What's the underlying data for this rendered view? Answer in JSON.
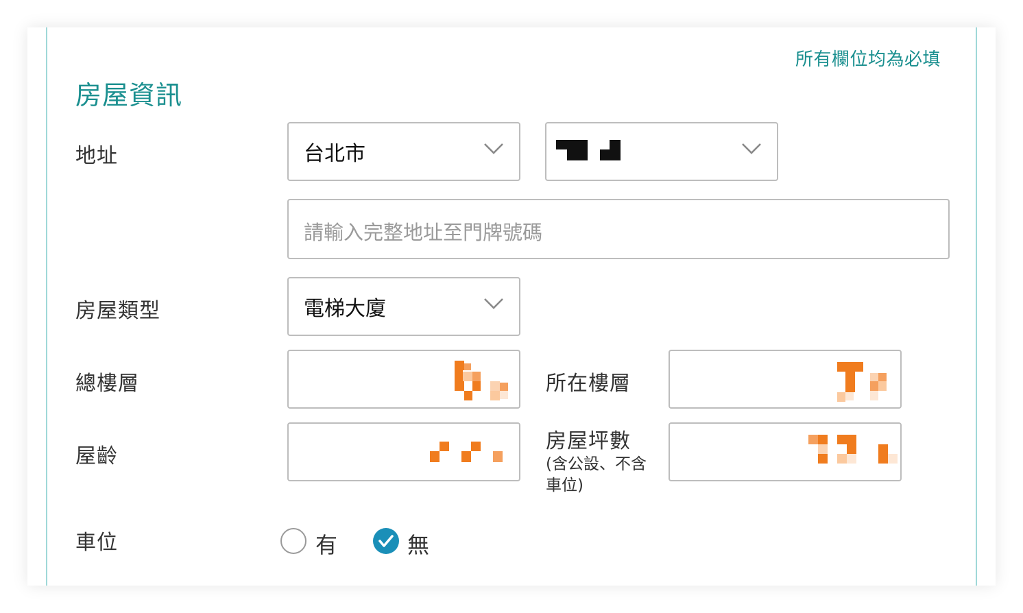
{
  "form": {
    "required_note": "所有欄位均為必填",
    "section_title": "房屋資訊",
    "address": {
      "label": "地址",
      "city": "台北市",
      "district_masked": true,
      "detail_placeholder": "請輸入完整地址至門牌號碼"
    },
    "house_type": {
      "label": "房屋類型",
      "value": "電梯大廈"
    },
    "total_floors": {
      "label": "總樓層",
      "value_masked": true
    },
    "floor": {
      "label": "所在樓層",
      "value_masked": true
    },
    "age": {
      "label": "屋齡",
      "value_masked": true
    },
    "area": {
      "label": "房屋坪數",
      "note": "(含公設、不含車位)",
      "value_masked": true
    },
    "parking": {
      "label": "車位",
      "options": [
        {
          "label": "有",
          "selected": false
        },
        {
          "label": "無",
          "selected": true
        }
      ]
    }
  },
  "colors": {
    "accent": "#1a8f8f",
    "radio_selected": "#1a8fb8",
    "mask_orange": "#f07c1e"
  }
}
